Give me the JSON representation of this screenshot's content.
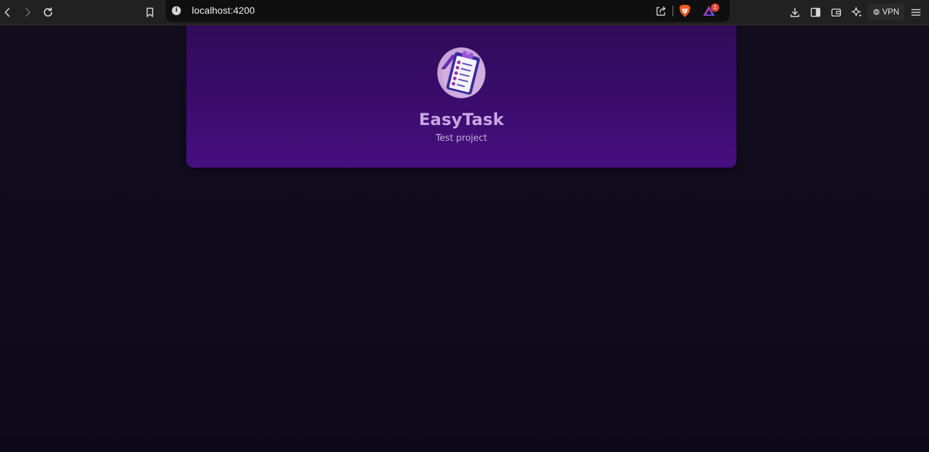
{
  "browser": {
    "url": "localhost:4200",
    "notification_count": "1",
    "vpn_label": "VPN",
    "icons": {
      "back": "chevron-left-icon",
      "forward": "chevron-right-icon",
      "reload": "reload-icon",
      "bookmark": "bookmark-icon",
      "site_info": "info-icon",
      "share": "share-icon",
      "brave_shields": "brave-lion-icon",
      "brave_rewards": "triangle-rewards-icon",
      "downloads": "download-icon",
      "sidebar": "sidebar-icon",
      "wallet": "wallet-icon",
      "leo_ai": "sparkle-icon",
      "menu": "hamburger-menu-icon"
    }
  },
  "header": {
    "title": "EasyTask",
    "subtitle": "Test project",
    "logo": "clipboard-checklist-icon"
  },
  "colors": {
    "page_background": "#0e0a19",
    "header_gradient_top": "#300b58",
    "header_gradient_bottom": "#470f80",
    "title_color": "#c9a6e2",
    "subtitle_color": "#c7b2dd",
    "badge_color": "#e5453a",
    "brave_orange": "#f15a22"
  }
}
